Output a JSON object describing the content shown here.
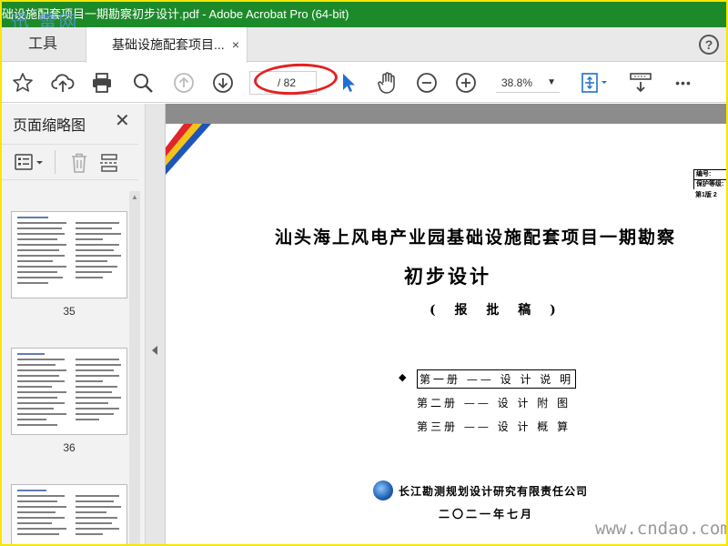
{
  "window": {
    "title": "础设施配套项目一期勘察初步设计.pdf - Adobe Acrobat Pro (64-bit)",
    "watermark_top": "迅 雷网"
  },
  "tabs": {
    "tools_label": "工具",
    "doc_label": "基础设施配套项目...",
    "close_glyph": "×",
    "help_glyph": "?"
  },
  "toolbar": {
    "page_current": "",
    "page_total": "/ 82",
    "zoom": "38.8%",
    "zoom_caret": "▼",
    "more_glyph": "•••"
  },
  "thumbnails": {
    "title": "页面缩略图",
    "close_glyph": "✕",
    "pages": [
      {
        "label": "35"
      },
      {
        "label": "36"
      },
      {
        "label": ""
      }
    ]
  },
  "document": {
    "info_rows": [
      "编号:",
      "保护等级:"
    ],
    "version": "第1版  2",
    "title": "汕头海上风电产业园基础设施配套项目一期勘察",
    "subtitle": "初步设计",
    "draft": "( 报 批 稿 )",
    "bullet": "◆",
    "volumes": [
      "第一册 —— 设 计 说 明",
      "第二册 —— 设 计 附 图",
      "第三册 —— 设 计 概 算"
    ],
    "company": "长江勘测规划设计研究有限责任公司",
    "date": "二〇二一年七月"
  },
  "colors": {
    "titlebar": "#1d8a2a",
    "border": "#f6e600",
    "annotation": "#e52020",
    "stripe_red": "#e0262b",
    "stripe_yellow": "#f3c418",
    "stripe_blue": "#1f54b8"
  },
  "watermark_bottom": "www.cndao.com"
}
